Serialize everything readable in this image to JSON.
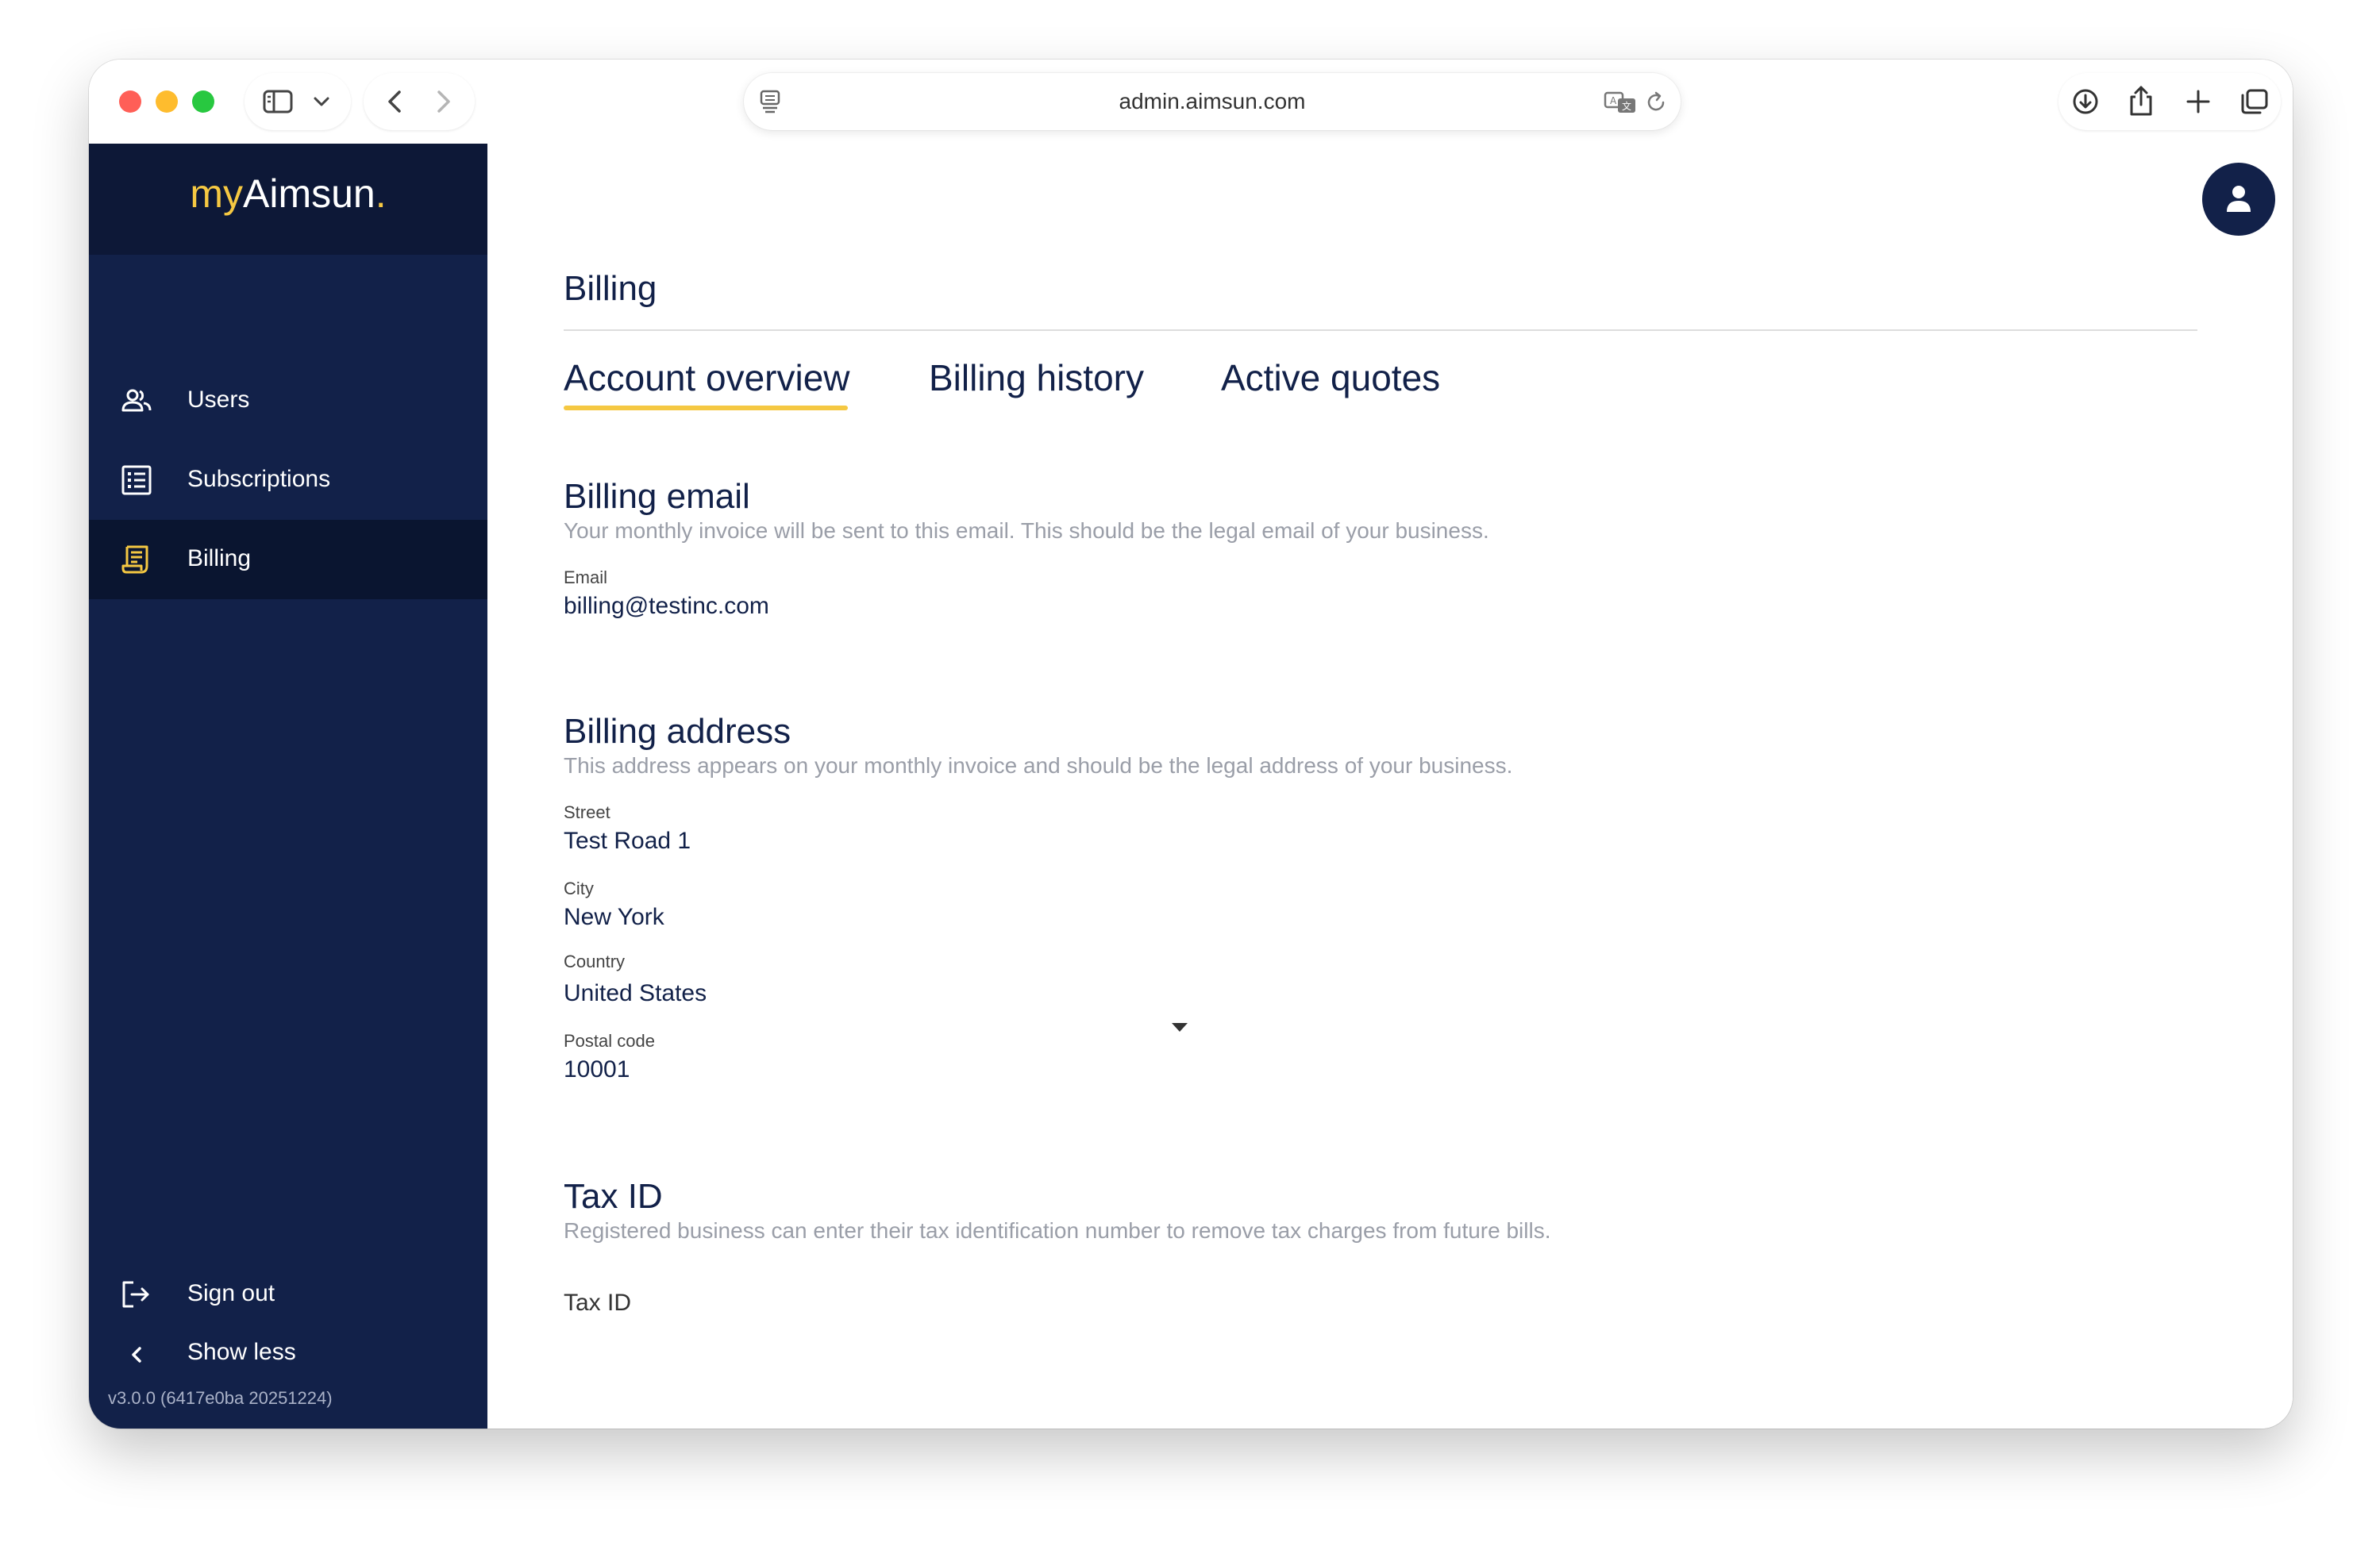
{
  "browser": {
    "url": "admin.aimsun.com"
  },
  "brand": {
    "prefix": "my",
    "name": "Aimsun",
    "suffix": "."
  },
  "sidebar": {
    "items": [
      {
        "label": "Users",
        "icon": "users-icon",
        "active": false
      },
      {
        "label": "Subscriptions",
        "icon": "list-icon",
        "active": false
      },
      {
        "label": "Billing",
        "icon": "receipt-icon",
        "active": true
      }
    ],
    "footer": [
      {
        "label": "Sign out",
        "icon": "sign-out-icon"
      },
      {
        "label": "Show less",
        "icon": "chevron-left-icon"
      }
    ],
    "version": "v3.0.0 (6417e0ba 20251224)"
  },
  "colors": {
    "navy": "#122149",
    "brand_dark": "#0d1837",
    "accent": "#f5c842",
    "muted_text": "#9a9ea8"
  },
  "main": {
    "title": "Billing",
    "tabs": [
      {
        "label": "Account overview",
        "active": true
      },
      {
        "label": "Billing history",
        "active": false
      },
      {
        "label": "Active quotes",
        "active": false
      }
    ],
    "billing_email": {
      "title": "Billing email",
      "description": "Your monthly invoice will be sent to this email. This should be the legal email of your business.",
      "email_label": "Email",
      "email_value": "billing@testinc.com"
    },
    "billing_address": {
      "title": "Billing address",
      "description": "This address appears on your monthly invoice and should be the legal address of your business.",
      "street_label": "Street",
      "street_value": "Test Road 1",
      "city_label": "City",
      "city_value": "New York",
      "country_label": "Country",
      "country_value": "United States",
      "postal_label": "Postal code",
      "postal_value": "10001"
    },
    "tax_id": {
      "title": "Tax ID",
      "description": "Registered business can enter their tax identification number to remove tax charges from future bills.",
      "input_label": "Tax ID"
    }
  }
}
